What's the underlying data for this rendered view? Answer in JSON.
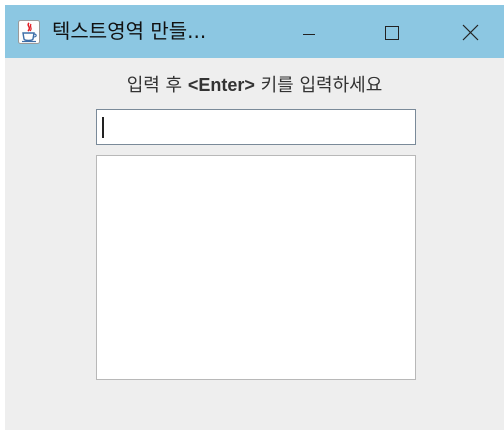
{
  "window": {
    "title": "텍스트영역 만들...",
    "controls": {
      "minimize_icon": "minimize-icon",
      "maximize_icon": "maximize-icon",
      "close_icon": "close-icon"
    },
    "titlebar_color": "#8cc7e2",
    "background_color": "#eeeeee"
  },
  "content": {
    "prompt_prefix": "입력 후 ",
    "prompt_key": "<Enter>",
    "prompt_suffix": " 키를 입력하세요",
    "input": {
      "value": "",
      "placeholder": ""
    },
    "textarea": {
      "value": ""
    }
  }
}
